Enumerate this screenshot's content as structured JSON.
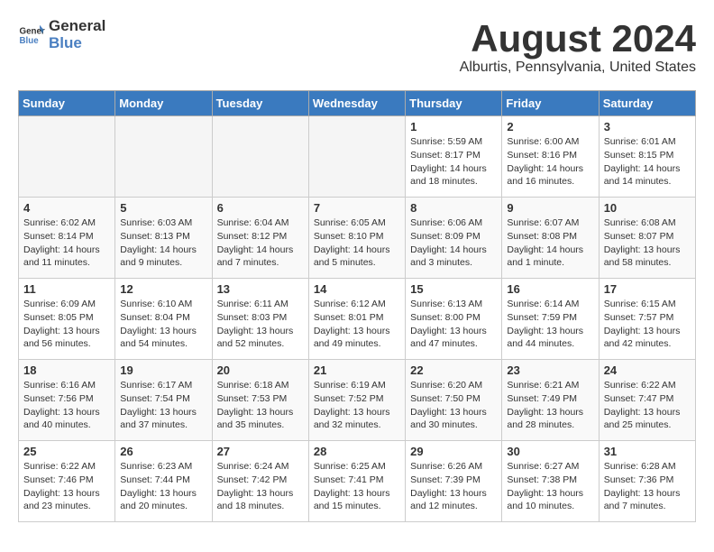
{
  "header": {
    "logo_general": "General",
    "logo_blue": "Blue",
    "month_title": "August 2024",
    "location": "Alburtis, Pennsylvania, United States"
  },
  "weekdays": [
    "Sunday",
    "Monday",
    "Tuesday",
    "Wednesday",
    "Thursday",
    "Friday",
    "Saturday"
  ],
  "weeks": [
    [
      {
        "day": "",
        "text": "",
        "empty": true
      },
      {
        "day": "",
        "text": "",
        "empty": true
      },
      {
        "day": "",
        "text": "",
        "empty": true
      },
      {
        "day": "",
        "text": "",
        "empty": true
      },
      {
        "day": "1",
        "text": "Sunrise: 5:59 AM\nSunset: 8:17 PM\nDaylight: 14 hours\nand 18 minutes."
      },
      {
        "day": "2",
        "text": "Sunrise: 6:00 AM\nSunset: 8:16 PM\nDaylight: 14 hours\nand 16 minutes."
      },
      {
        "day": "3",
        "text": "Sunrise: 6:01 AM\nSunset: 8:15 PM\nDaylight: 14 hours\nand 14 minutes."
      }
    ],
    [
      {
        "day": "4",
        "text": "Sunrise: 6:02 AM\nSunset: 8:14 PM\nDaylight: 14 hours\nand 11 minutes."
      },
      {
        "day": "5",
        "text": "Sunrise: 6:03 AM\nSunset: 8:13 PM\nDaylight: 14 hours\nand 9 minutes."
      },
      {
        "day": "6",
        "text": "Sunrise: 6:04 AM\nSunset: 8:12 PM\nDaylight: 14 hours\nand 7 minutes."
      },
      {
        "day": "7",
        "text": "Sunrise: 6:05 AM\nSunset: 8:10 PM\nDaylight: 14 hours\nand 5 minutes."
      },
      {
        "day": "8",
        "text": "Sunrise: 6:06 AM\nSunset: 8:09 PM\nDaylight: 14 hours\nand 3 minutes."
      },
      {
        "day": "9",
        "text": "Sunrise: 6:07 AM\nSunset: 8:08 PM\nDaylight: 14 hours\nand 1 minute."
      },
      {
        "day": "10",
        "text": "Sunrise: 6:08 AM\nSunset: 8:07 PM\nDaylight: 13 hours\nand 58 minutes."
      }
    ],
    [
      {
        "day": "11",
        "text": "Sunrise: 6:09 AM\nSunset: 8:05 PM\nDaylight: 13 hours\nand 56 minutes."
      },
      {
        "day": "12",
        "text": "Sunrise: 6:10 AM\nSunset: 8:04 PM\nDaylight: 13 hours\nand 54 minutes."
      },
      {
        "day": "13",
        "text": "Sunrise: 6:11 AM\nSunset: 8:03 PM\nDaylight: 13 hours\nand 52 minutes."
      },
      {
        "day": "14",
        "text": "Sunrise: 6:12 AM\nSunset: 8:01 PM\nDaylight: 13 hours\nand 49 minutes."
      },
      {
        "day": "15",
        "text": "Sunrise: 6:13 AM\nSunset: 8:00 PM\nDaylight: 13 hours\nand 47 minutes."
      },
      {
        "day": "16",
        "text": "Sunrise: 6:14 AM\nSunset: 7:59 PM\nDaylight: 13 hours\nand 44 minutes."
      },
      {
        "day": "17",
        "text": "Sunrise: 6:15 AM\nSunset: 7:57 PM\nDaylight: 13 hours\nand 42 minutes."
      }
    ],
    [
      {
        "day": "18",
        "text": "Sunrise: 6:16 AM\nSunset: 7:56 PM\nDaylight: 13 hours\nand 40 minutes."
      },
      {
        "day": "19",
        "text": "Sunrise: 6:17 AM\nSunset: 7:54 PM\nDaylight: 13 hours\nand 37 minutes."
      },
      {
        "day": "20",
        "text": "Sunrise: 6:18 AM\nSunset: 7:53 PM\nDaylight: 13 hours\nand 35 minutes."
      },
      {
        "day": "21",
        "text": "Sunrise: 6:19 AM\nSunset: 7:52 PM\nDaylight: 13 hours\nand 32 minutes."
      },
      {
        "day": "22",
        "text": "Sunrise: 6:20 AM\nSunset: 7:50 PM\nDaylight: 13 hours\nand 30 minutes."
      },
      {
        "day": "23",
        "text": "Sunrise: 6:21 AM\nSunset: 7:49 PM\nDaylight: 13 hours\nand 28 minutes."
      },
      {
        "day": "24",
        "text": "Sunrise: 6:22 AM\nSunset: 7:47 PM\nDaylight: 13 hours\nand 25 minutes."
      }
    ],
    [
      {
        "day": "25",
        "text": "Sunrise: 6:22 AM\nSunset: 7:46 PM\nDaylight: 13 hours\nand 23 minutes."
      },
      {
        "day": "26",
        "text": "Sunrise: 6:23 AM\nSunset: 7:44 PM\nDaylight: 13 hours\nand 20 minutes."
      },
      {
        "day": "27",
        "text": "Sunrise: 6:24 AM\nSunset: 7:42 PM\nDaylight: 13 hours\nand 18 minutes."
      },
      {
        "day": "28",
        "text": "Sunrise: 6:25 AM\nSunset: 7:41 PM\nDaylight: 13 hours\nand 15 minutes."
      },
      {
        "day": "29",
        "text": "Sunrise: 6:26 AM\nSunset: 7:39 PM\nDaylight: 13 hours\nand 12 minutes."
      },
      {
        "day": "30",
        "text": "Sunrise: 6:27 AM\nSunset: 7:38 PM\nDaylight: 13 hours\nand 10 minutes."
      },
      {
        "day": "31",
        "text": "Sunrise: 6:28 AM\nSunset: 7:36 PM\nDaylight: 13 hours\nand 7 minutes."
      }
    ]
  ]
}
